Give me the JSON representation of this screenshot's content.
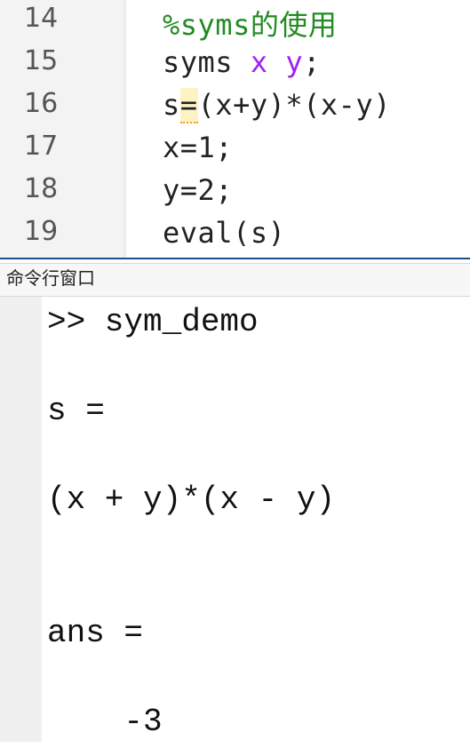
{
  "editor": {
    "lines": [
      {
        "number": "14",
        "parts": [
          {
            "text": "%syms的使用",
            "kind": "comment"
          }
        ]
      },
      {
        "number": "15",
        "parts": [
          {
            "text": "syms ",
            "kind": "plain"
          },
          {
            "text": "x",
            "kind": "symvar"
          },
          {
            "text": " ",
            "kind": "plain"
          },
          {
            "text": "y",
            "kind": "symvar"
          },
          {
            "text": ";",
            "kind": "plain"
          }
        ]
      },
      {
        "number": "16",
        "parts": [
          {
            "text": "s",
            "kind": "plain"
          },
          {
            "text": "=",
            "kind": "warn"
          },
          {
            "text": "(x+y)*(x-y)",
            "kind": "plain"
          }
        ]
      },
      {
        "number": "17",
        "parts": [
          {
            "text": "x=1;",
            "kind": "plain"
          }
        ]
      },
      {
        "number": "18",
        "parts": [
          {
            "text": "y=2;",
            "kind": "plain"
          }
        ]
      },
      {
        "number": "19",
        "parts": [
          {
            "text": "eval(s)",
            "kind": "plain"
          }
        ]
      }
    ],
    "colors": {
      "comment": "#228b22",
      "symvar": "#a020f0",
      "warning_highlight": "#fff3c4"
    }
  },
  "command_window": {
    "title": "命令行窗口",
    "lines": [
      ">> sym_demo",
      "",
      "s =",
      "",
      "(x + y)*(x - y)",
      "",
      "",
      "ans =",
      "",
      "    -3"
    ]
  }
}
